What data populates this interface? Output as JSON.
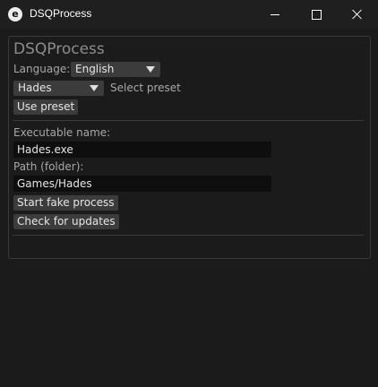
{
  "window": {
    "title": "DSQProcess",
    "icon_letter": "e"
  },
  "main": {
    "heading": "DSQProcess",
    "language_label": "Language:",
    "language_value": "English",
    "preset_value": "Hades",
    "preset_hint": "Select preset",
    "use_preset_label": "Use preset",
    "exe_label": "Executable name:",
    "exe_value": "Hades.exe",
    "path_label": "Path (folder):",
    "path_value": "Games/Hades",
    "start_label": "Start fake process",
    "updates_label": "Check for updates"
  }
}
